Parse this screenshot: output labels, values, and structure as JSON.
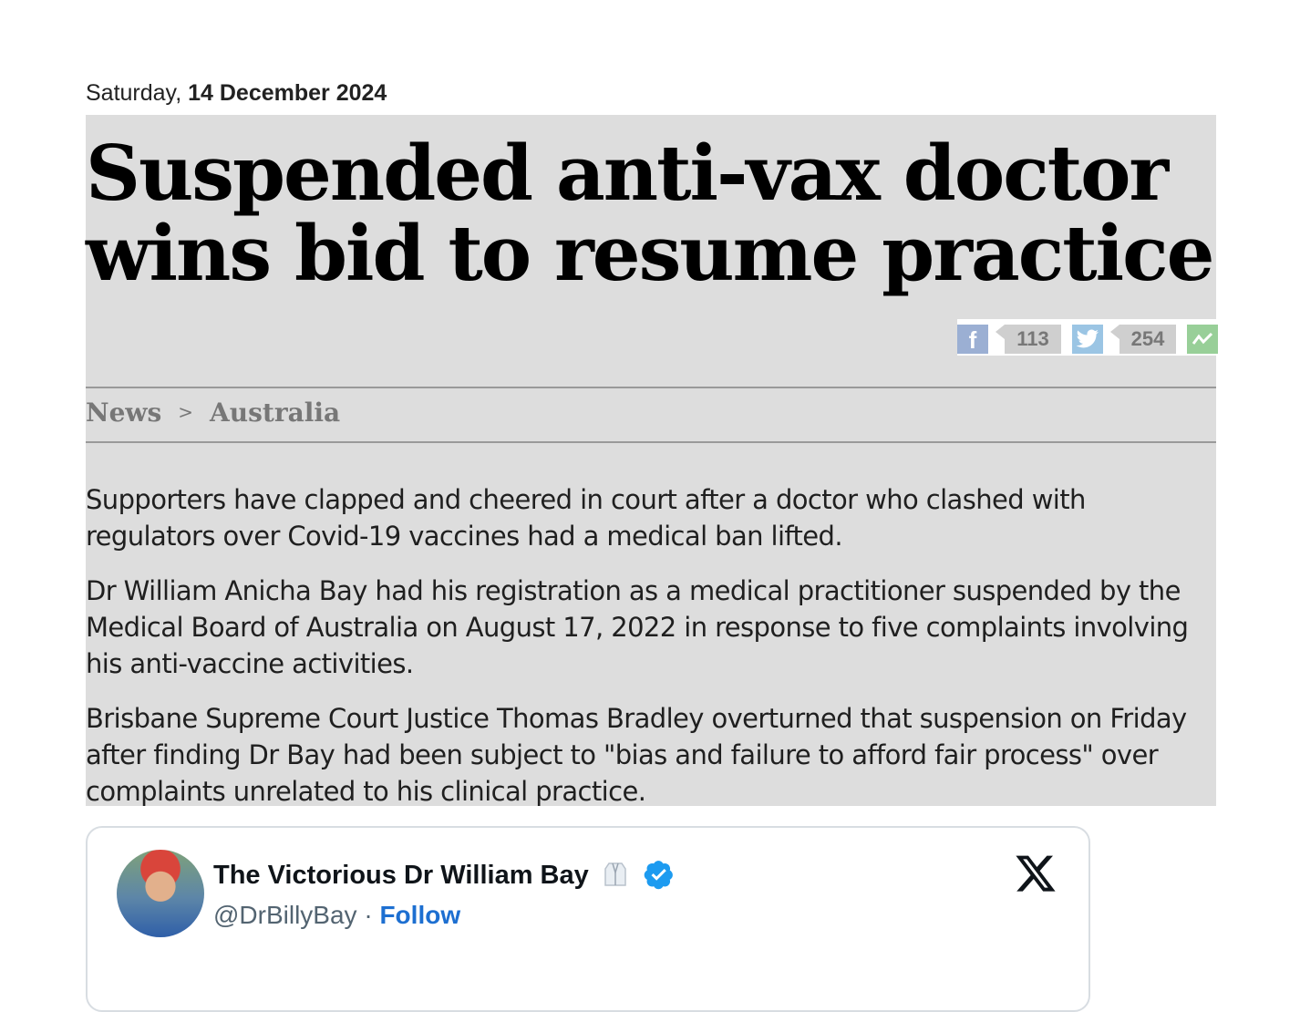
{
  "date": {
    "weekday": "Saturday,",
    "full": "14 December 2024"
  },
  "article": {
    "headline": "Suspended anti-vax doctor wins bid to resume practice",
    "share": {
      "facebook_count": "113",
      "twitter_count": "254"
    },
    "breadcrumb": {
      "section": "News",
      "separator": ">",
      "subsection": "Australia"
    },
    "paragraphs": [
      "Supporters have clapped and cheered in court after a doctor who clashed with regulators over Covid-19 vaccines had a medical ban lifted.",
      "Dr William Anicha Bay had his registration as a medical practitioner suspended by the Medical Board of Australia on August 17, 2022 in response to five complaints involving his anti-vaccine activities.",
      "Brisbane Supreme Court Justice Thomas Bradley overturned that suspension on Friday after finding Dr Bay had been subject to \"bias and failure to afford fair process\" over complaints unrelated to his clinical practice."
    ]
  },
  "tweet": {
    "display_name": "The Victorious Dr William Bay",
    "handle": "@DrBillyBay",
    "separator": "·",
    "follow_label": "Follow",
    "icons": [
      "lab-coat-icon",
      "verified-badge-icon",
      "x-logo-icon"
    ]
  },
  "colors": {
    "article_bg": "#dddddd",
    "follow": "#1d6fd1",
    "verified": "#1d9bf0"
  }
}
